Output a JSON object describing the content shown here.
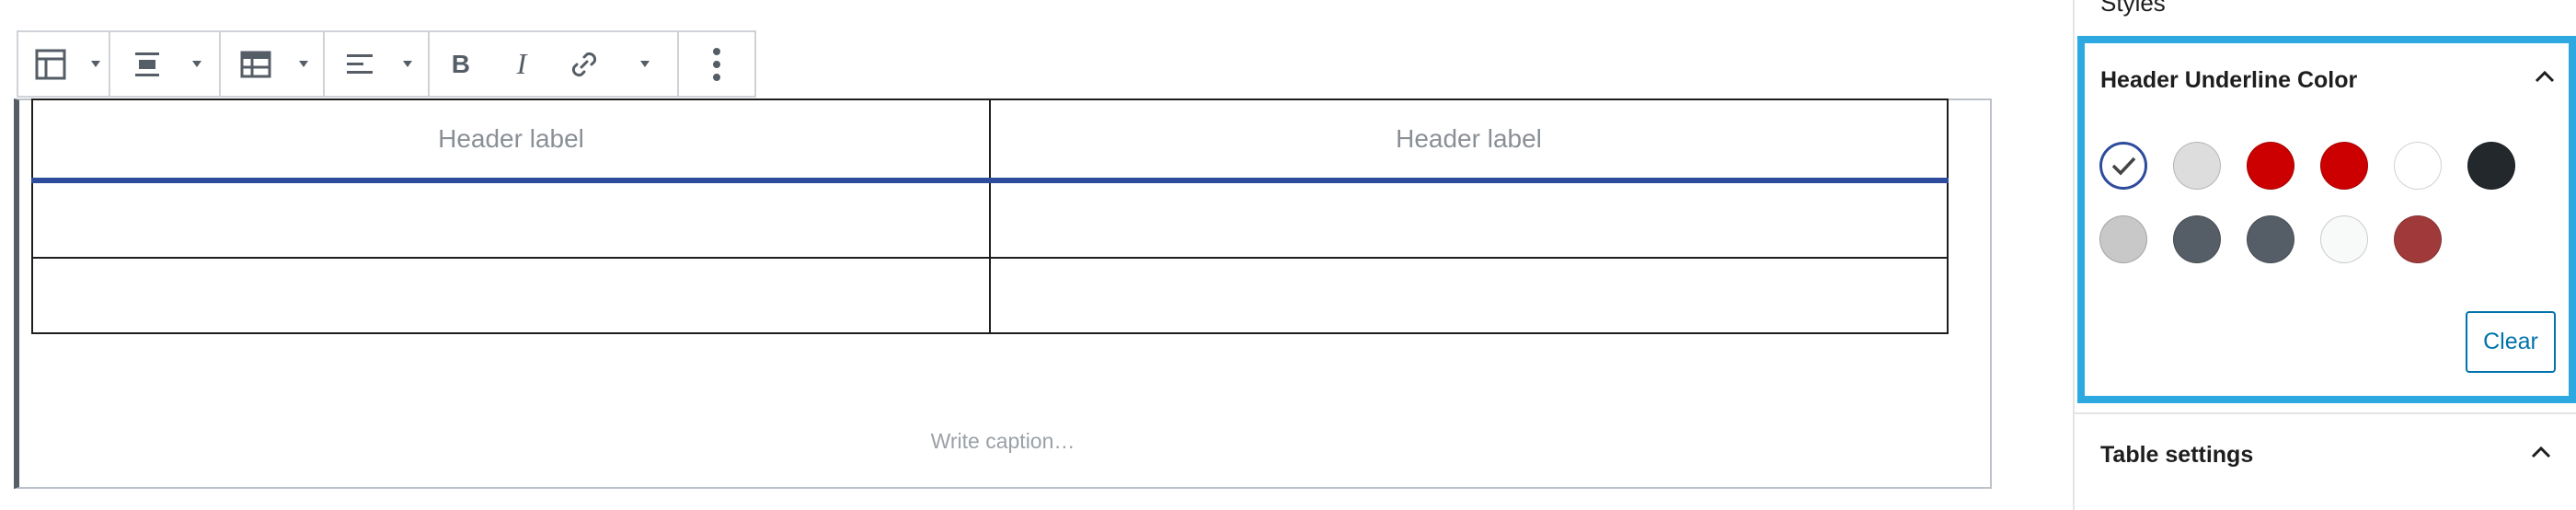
{
  "toolbar": {
    "groups": [
      {
        "name": "table",
        "icon": "table-icon",
        "has_dropdown": true
      },
      {
        "name": "alignment",
        "icon": "align-center-icon",
        "has_dropdown": true
      },
      {
        "name": "edit-table",
        "icon": "table-edit-icon",
        "has_dropdown": true
      },
      {
        "name": "text-align",
        "icon": "align-left-icon",
        "has_dropdown": true
      },
      {
        "name": "formatting",
        "items": [
          "bold-icon",
          "italic-icon",
          "link-icon",
          "more-rich-text-icon"
        ]
      },
      {
        "name": "options",
        "icon": "more-vertical-icon"
      }
    ],
    "bold_glyph": "B",
    "italic_glyph": "I"
  },
  "table": {
    "headers": [
      "Header label",
      "Header label"
    ],
    "rows": [
      [
        "",
        ""
      ],
      [
        "",
        ""
      ]
    ],
    "header_underline_color": "#2e4b9c"
  },
  "caption": {
    "placeholder": "Write caption…"
  },
  "sidebar": {
    "styles_label": "Styles",
    "color_panel": {
      "title": "Header Underline Color",
      "expanded": true,
      "selected_index": 0,
      "swatches": [
        {
          "color": "#ffffff",
          "selected": true
        },
        {
          "color": "#dddddd"
        },
        {
          "color": "#cc0000"
        },
        {
          "color": "#cc0000"
        },
        {
          "color": "#ffffff"
        },
        {
          "color": "#23282d"
        },
        {
          "color": "#c8c8c8"
        },
        {
          "color": "#555d66"
        },
        {
          "color": "#555d66"
        },
        {
          "color": "#f8f9f9"
        },
        {
          "color": "#a03a3a"
        }
      ],
      "clear_label": "Clear"
    },
    "table_settings": {
      "title": "Table settings",
      "expanded": true
    }
  },
  "colors": {
    "accent_border": "#2ea8e0",
    "link": "#0073aa"
  }
}
